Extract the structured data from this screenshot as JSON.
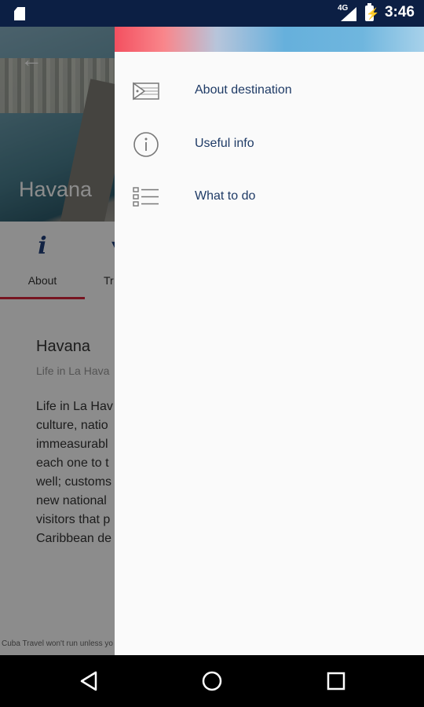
{
  "status_bar": {
    "network": "4G",
    "time": "3:46",
    "icons": [
      "sim-card-icon",
      "signal-icon",
      "battery-charging-icon"
    ]
  },
  "hero": {
    "title": "Havana",
    "back_icon": "back-arrow-icon"
  },
  "tabs": [
    {
      "label": "About",
      "icon": "info-icon",
      "selected": true
    },
    {
      "label": "Tr",
      "icon": "tab-icon"
    }
  ],
  "content": {
    "title": "Havana",
    "subtitle": "Life in La Hava",
    "body_lines": [
      "Life in La Hav",
      "culture, natio",
      "immeasurabl",
      "each one to t",
      "well; customs",
      "new national",
      "visitors that p",
      "Caribbean de"
    ]
  },
  "footer_note": "Cuba Travel won't run unless yo",
  "drawer": {
    "items": [
      {
        "label": "About destination",
        "icon": "flag-icon"
      },
      {
        "label": "Useful info",
        "icon": "info-circle-icon"
      },
      {
        "label": "What to do",
        "icon": "checklist-icon"
      }
    ]
  },
  "nav_bar": {
    "buttons": [
      "back-triangle-icon",
      "home-circle-icon",
      "recents-square-icon"
    ]
  },
  "colors": {
    "status_bar": "#0c1f44",
    "drawer_text": "#1f3b66",
    "tab_accent": "#d9273c",
    "header_gradient_left": "#f35060",
    "header_gradient_right": "#66b0dc"
  }
}
